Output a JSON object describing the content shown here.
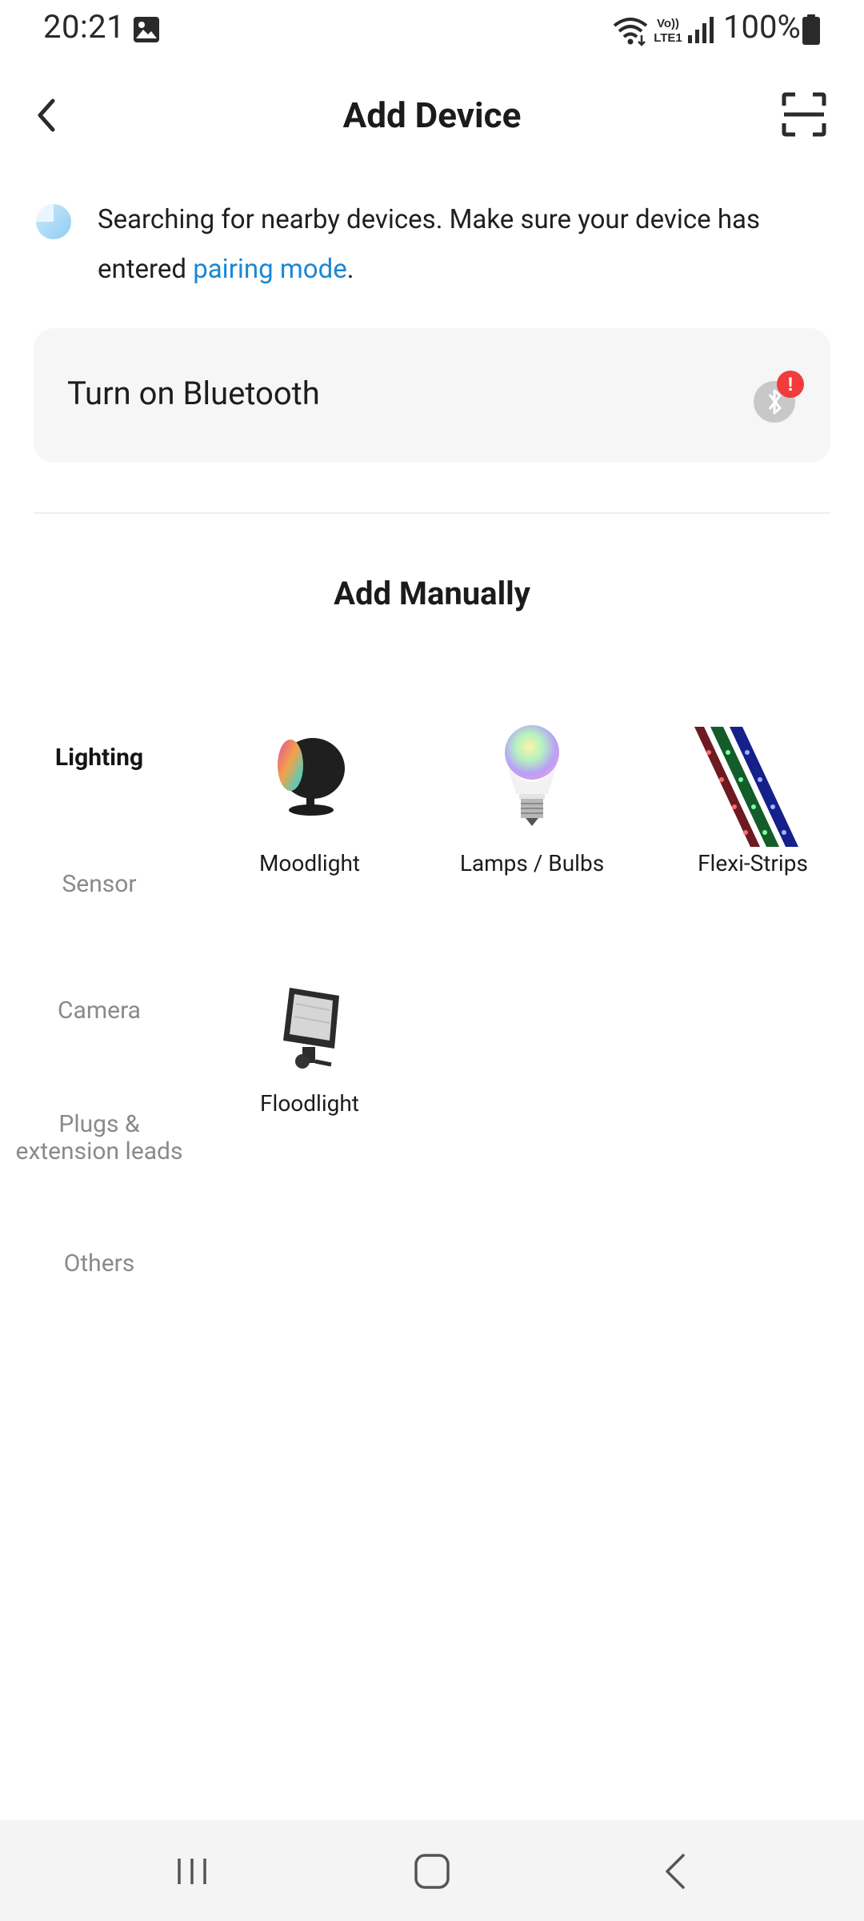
{
  "status_bar": {
    "time": "20:21",
    "battery": "100%",
    "icons": [
      "gallery-icon",
      "wifi-icon",
      "volte-lte-icon",
      "signal-icon",
      "battery-icon"
    ]
  },
  "header": {
    "title": "Add Device",
    "back_icon": "chevron-left-icon",
    "scan_icon": "scan-frame-icon"
  },
  "search_notice": {
    "text_before": "Searching for nearby devices. Make sure your device has entered ",
    "link": "pairing mode",
    "text_after": "."
  },
  "bluetooth": {
    "label": "Turn on Bluetooth",
    "icon": "bluetooth-off-icon",
    "badge": "!"
  },
  "add_manually": {
    "title": "Add Manually",
    "categories": [
      {
        "label": "Lighting",
        "active": true
      },
      {
        "label": "Sensor",
        "active": false
      },
      {
        "label": "Camera",
        "active": false
      },
      {
        "label": "Plugs & extension leads",
        "active": false
      },
      {
        "label": "Others",
        "active": false
      }
    ],
    "devices": [
      {
        "label": "Moodlight",
        "icon": "moodlight-image"
      },
      {
        "label": "Lamps / Bulbs",
        "icon": "bulb-image"
      },
      {
        "label": "Flexi-Strips",
        "icon": "led-strip-image"
      },
      {
        "label": "Floodlight",
        "icon": "floodlight-image"
      }
    ]
  },
  "colors": {
    "link": "#1a87d6",
    "card_bg": "#f6f6f6",
    "badge": "#f23b3b",
    "nav_bg": "#f4f4f4"
  }
}
